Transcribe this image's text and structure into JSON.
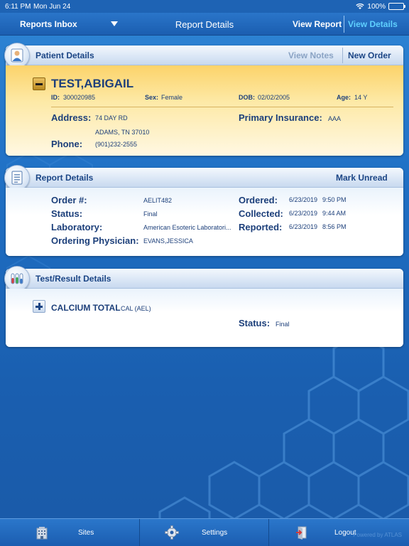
{
  "status_bar": {
    "time": "6:11 PM",
    "date": "Mon Jun 24",
    "battery": "100%"
  },
  "nav": {
    "inbox": "Reports Inbox",
    "title": "Report Details",
    "view_report": "View Report",
    "view_details": "View Details"
  },
  "patient_panel": {
    "title": "Patient Details",
    "view_notes": "View Notes",
    "new_order": "New Order",
    "name": "TEST,ABIGAIL",
    "id_label": "ID:",
    "id_value": "300020985",
    "sex_label": "Sex:",
    "sex_value": "Female",
    "dob_label": "DOB:",
    "dob_value": "02/02/2005",
    "age_label": "Age:",
    "age_value": "14 Y",
    "address_label": "Address:",
    "address_line1": "74 DAY RD",
    "address_line2": "ADAMS, TN 37010",
    "insurance_label": "Primary Insurance:",
    "insurance_value": "AAA",
    "phone_label": "Phone:",
    "phone_value": "(901)232-2555"
  },
  "report_panel": {
    "title": "Report Details",
    "mark_unread": "Mark Unread",
    "order_label": "Order #:",
    "order_value": "AELIT482",
    "status_label": "Status:",
    "status_value": "Final",
    "lab_label": "Laboratory:",
    "lab_value": "American Esoteric Laboratori...",
    "physician_label": "Ordering Physician:",
    "physician_value": "EVANS,JESSICA",
    "ordered_label": "Ordered:",
    "ordered_date": "6/23/2019",
    "ordered_time": "9:50 PM",
    "collected_label": "Collected:",
    "collected_date": "6/23/2019",
    "collected_time": "9:44 AM",
    "reported_label": "Reported:",
    "reported_date": "6/23/2019",
    "reported_time": "8:56 PM"
  },
  "test_panel": {
    "title": "Test/Result Details",
    "test_name": "CALCIUM TOTAL",
    "test_code": "CAL (AEL)",
    "status_label": "Status:",
    "status_value": "Final"
  },
  "tabbar": {
    "sites": "Sites",
    "settings": "Settings",
    "logout": "Logout",
    "powered": "Powered by ATLAS"
  },
  "icons": {
    "wifi": "wifi-icon",
    "battery": "battery-icon",
    "patient": "patient-avatar-icon",
    "report": "report-document-icon",
    "test": "test-tubes-icon",
    "sites": "building-icon",
    "settings": "gear-icon",
    "logout": "logout-door-icon"
  },
  "colors": {
    "nav_active": "#5fd0ff",
    "patient_header_bg": "#fcd36a",
    "label_blue": "#1c3f7a",
    "link_gray": "#8aa3c4"
  }
}
